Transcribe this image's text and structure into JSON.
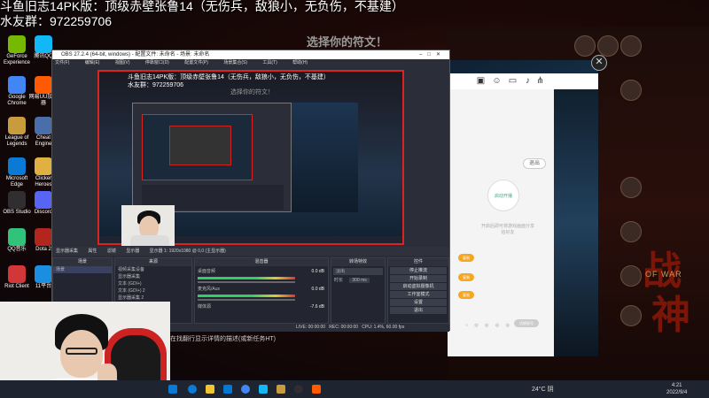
{
  "overlay": {
    "stream_title": "斗鱼旧志14PK版：顶级赤壁张鲁14（无伤兵，敌狼小，无负伤，不基建）",
    "stream_id": "水友群：972259706",
    "choose_rune": "选择你的符文！",
    "hint": "在找翻行显示详情的描述(或新任务HT)"
  },
  "desktop_icons": [
    {
      "label": "GeForce Experience",
      "color": "#76b900"
    },
    {
      "label": "Google Chrome",
      "color": "#4285f4"
    },
    {
      "label": "League of Legends",
      "color": "#c89b3c"
    },
    {
      "label": "Microsoft Edge",
      "color": "#0a7ad6"
    },
    {
      "label": "OBS Studio",
      "color": "#302e31"
    },
    {
      "label": "QQ音乐",
      "color": "#31c27c"
    },
    {
      "label": "Riot Client",
      "color": "#d13639"
    },
    {
      "label": "腾讯QQ",
      "color": "#12b7f5"
    },
    {
      "label": "网易UU加速器",
      "color": "#ff5a00"
    },
    {
      "label": "Cheat Engine",
      "color": "#4a6ea9"
    },
    {
      "label": "Clicker Heroes",
      "color": "#e0b040"
    },
    {
      "label": "Discord",
      "color": "#5865f2"
    },
    {
      "label": "Dota 2",
      "color": "#b3261e"
    },
    {
      "label": "11平台",
      "color": "#1b8ee0"
    }
  ],
  "obs": {
    "title": "OBS 27.2.4 (64-bit, windows) - 配置文件: 未命名 - 场景: 未命名",
    "menu": [
      "文件(F)",
      "编辑(E)",
      "视图(V)",
      "停靠窗口(D)",
      "配置文件(P)",
      "场景集合(S)",
      "工具(T)",
      "帮助(H)"
    ],
    "scenebar": [
      "显示器采集",
      "属性",
      "滤镜",
      "显示器",
      "显示器 1: 1920x1080 @ 0,0 (主显示器)"
    ],
    "docks": {
      "scenes": {
        "title": "场景",
        "items": [
          "场景"
        ]
      },
      "sources": {
        "title": "来源",
        "items": [
          "视频采集设备",
          "显示器采集",
          "文本 (GDI+)",
          "文本 (GDI+) 2",
          "显示器采集 2"
        ]
      },
      "mixer": {
        "title": "混音器",
        "items": [
          "桌面音频",
          "麦克风/Aux",
          "媒体源"
        ],
        "levels": [
          "0.0 dB",
          "0.0 dB",
          "-7.6 dB"
        ]
      },
      "transitions": {
        "title": "转场特效",
        "type": "淡出",
        "duration_label": "时长",
        "duration": "300 ms"
      },
      "controls": {
        "title": "控件",
        "buttons": [
          "停止推流",
          "开始录制",
          "启动虚拟摄像机",
          "工作室模式",
          "设置",
          "退出"
        ]
      }
    },
    "status": [
      "LIVE: 00:00:00",
      "REC: 00:00:00",
      "CPU: 1.4%, 60.00 fps"
    ]
  },
  "dialog": {
    "exit": "退出",
    "start": "启动开播",
    "note": "开启后即可将游戏画面分享给好友",
    "pills": [
      "复制",
      "复制",
      "复制"
    ],
    "footer": "切换账号"
  },
  "game": {
    "logo": "战",
    "logo2": "神",
    "subtitle": "OF WAR"
  },
  "taskbar": {
    "weather": "24°C 阴",
    "time": "4:21",
    "date": "2022/9/4"
  }
}
